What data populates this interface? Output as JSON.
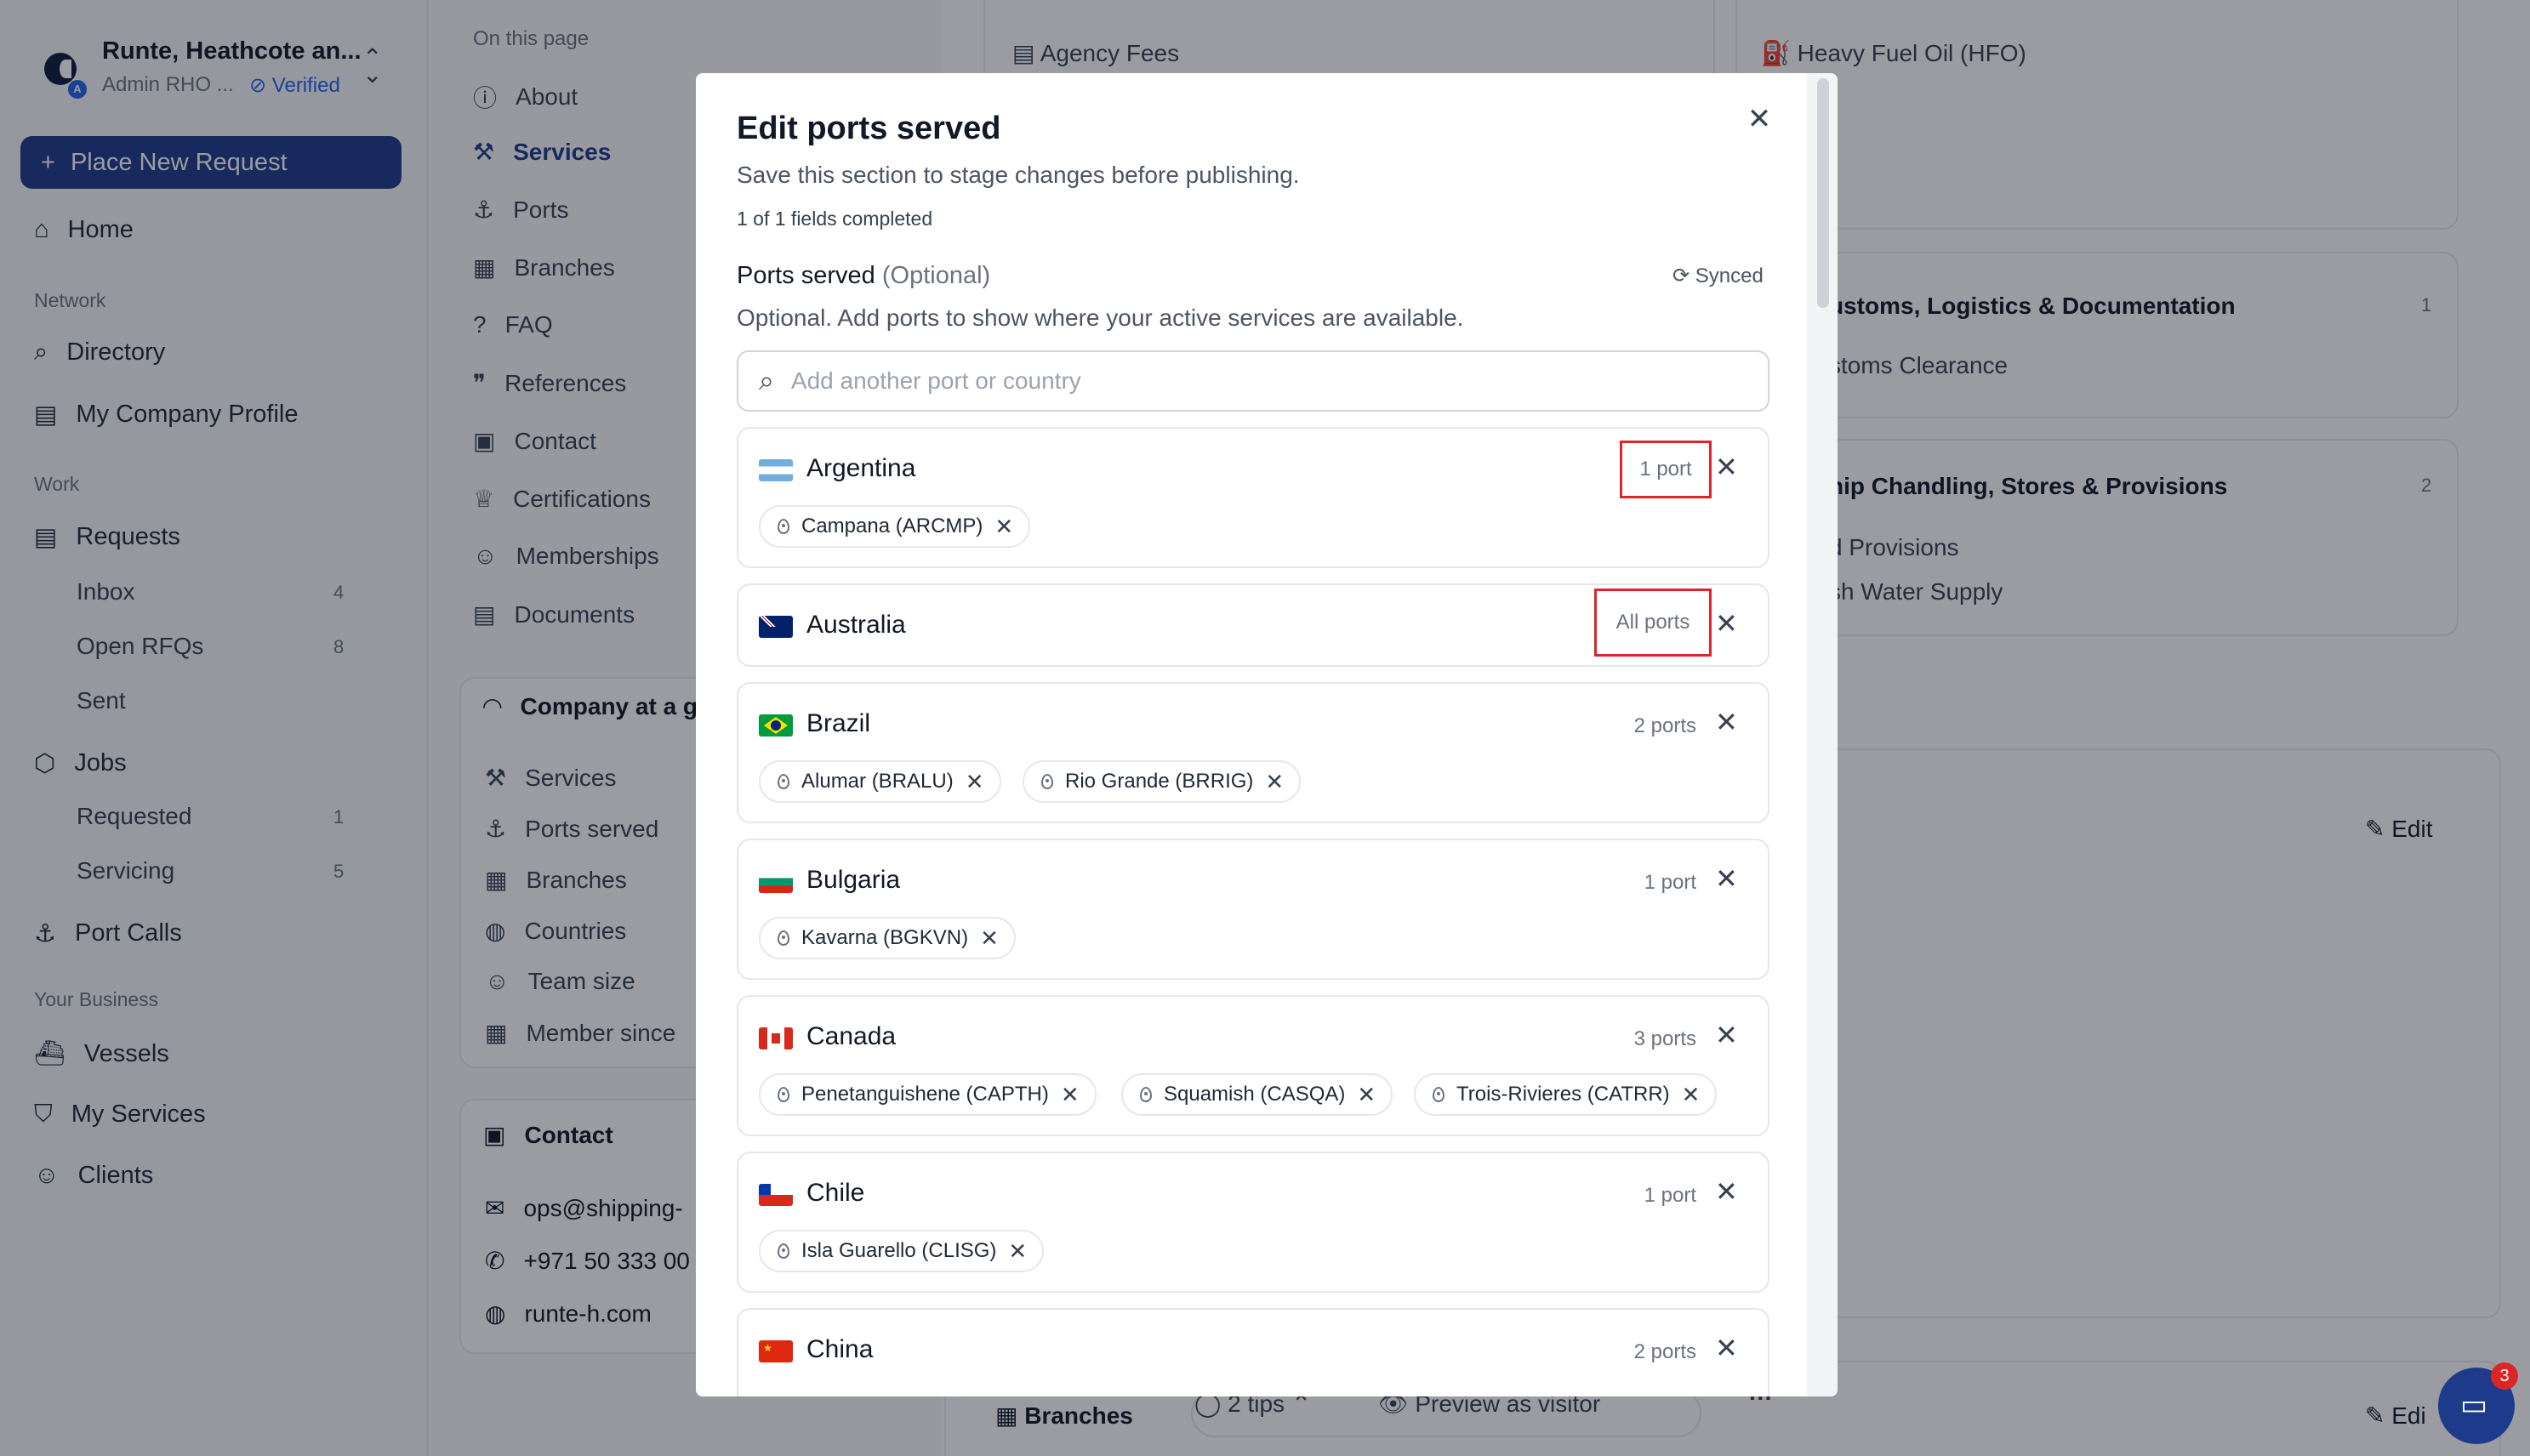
{
  "sidebar": {
    "company_name": "Runte, Heathcote an...",
    "role": "Admin RHO ...",
    "verified": "Verified",
    "new_request": "Place New Request",
    "home": "Home",
    "section_network": "Network",
    "directory": "Directory",
    "company_profile": "My Company Profile",
    "section_work": "Work",
    "requests": "Requests",
    "inbox": "Inbox",
    "inbox_count": "4",
    "open_rfqs": "Open RFQs",
    "open_rfqs_count": "8",
    "sent": "Sent",
    "jobs": "Jobs",
    "requested": "Requested",
    "requested_count": "1",
    "servicing": "Servicing",
    "servicing_count": "5",
    "port_calls": "Port Calls",
    "section_business": "Your Business",
    "vessels": "Vessels",
    "my_services": "My Services",
    "clients": "Clients"
  },
  "page_nav": {
    "heading": "On this page",
    "items": [
      "About",
      "Services",
      "Ports",
      "Branches",
      "FAQ",
      "References",
      "Contact",
      "Certifications",
      "Memberships",
      "Documents"
    ],
    "glance_title": "Company at a g",
    "glance_items": [
      "Services",
      "Ports served",
      "Branches",
      "Countries",
      "Team size",
      "Member since"
    ],
    "contact_title": "Contact",
    "contact_email": "ops@shipping-",
    "contact_phone": "+971 50 333 00",
    "contact_web": "runte-h.com"
  },
  "background": {
    "agency_fees": "Agency Fees",
    "hfo": "Heavy Fuel Oil (HFO)",
    "customs_title": "ustoms, Logistics & Documentation",
    "customs_count": "1",
    "customs_item": "stoms Clearance",
    "chandling_title": "hip Chandling, Stores & Provisions",
    "chandling_count": "2",
    "chandling_item1": "d Provisions",
    "chandling_item2": "sh Water Supply",
    "edit": "Edit",
    "edit2": "Edi",
    "branches": "Branches",
    "tips": "2 tips",
    "preview": "Preview as visitor",
    "chat_badge": "3"
  },
  "modal": {
    "title": "Edit ports served",
    "subtitle": "Save this section to stage changes before publishing.",
    "progress": "1 of 1 fields completed",
    "field_label": "Ports served",
    "field_optional": "(Optional)",
    "synced": "Synced",
    "help": "Optional. Add ports to show where your active services are available.",
    "search_placeholder": "Add another port or country",
    "countries": [
      {
        "name": "Argentina",
        "count": "1 port",
        "ports": [
          "Campana (ARCMP)"
        ]
      },
      {
        "name": "Australia",
        "count": "All ports",
        "ports": []
      },
      {
        "name": "Brazil",
        "count": "2 ports",
        "ports": [
          "Alumar (BRALU)",
          "Rio Grande (BRRIG)"
        ]
      },
      {
        "name": "Bulgaria",
        "count": "1 port",
        "ports": [
          "Kavarna (BGKVN)"
        ]
      },
      {
        "name": "Canada",
        "count": "3 ports",
        "ports": [
          "Penetanguishene (CAPTH)",
          "Squamish (CASQA)",
          "Trois-Rivieres (CATRR)"
        ]
      },
      {
        "name": "Chile",
        "count": "1 port",
        "ports": [
          "Isla Guarello (CLISG)"
        ]
      },
      {
        "name": "China",
        "count": "2 ports",
        "ports": []
      }
    ]
  },
  "colors": {
    "primary": "#1e3a8a",
    "highlight": "#e0242b"
  }
}
